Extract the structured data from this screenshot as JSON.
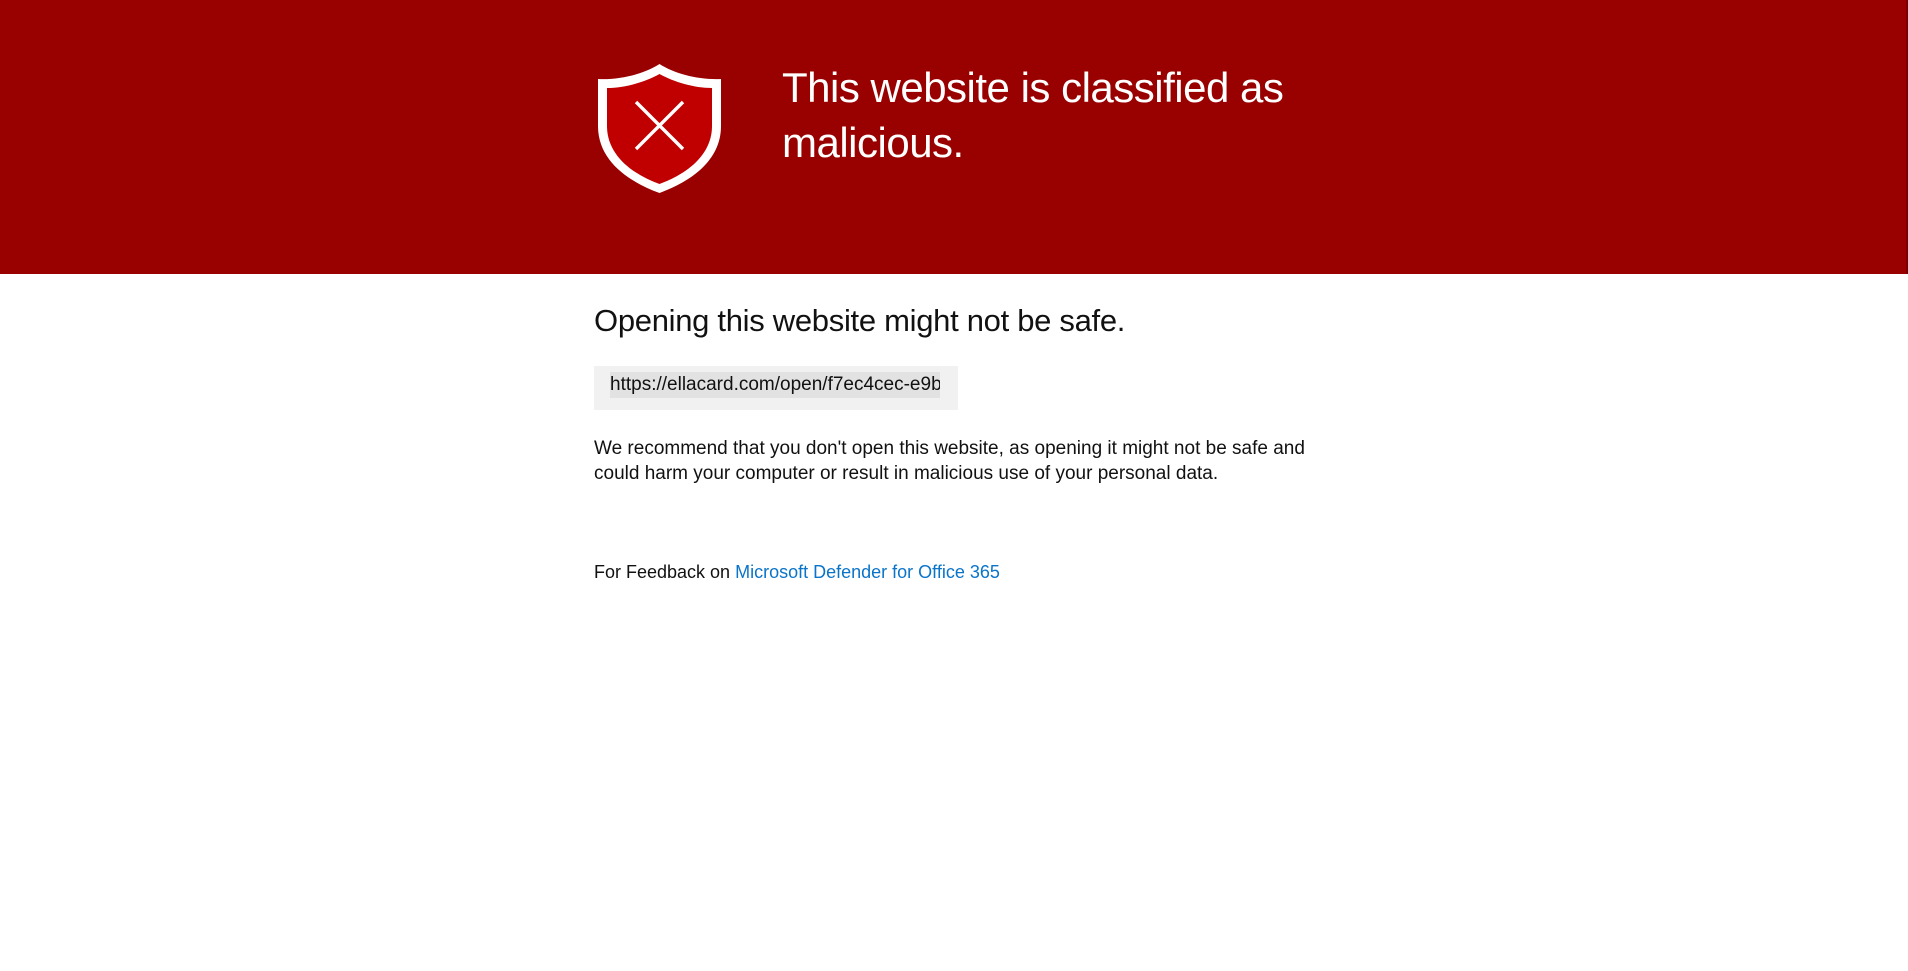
{
  "banner": {
    "title": "This website is classified as malicious.",
    "icon": "shield-x-icon",
    "background_color": "#990000",
    "shield_color": "#c00000"
  },
  "main": {
    "subheading": "Opening this website might not be safe.",
    "url": "https://ellacard.com/open/f7ec4cec-e9b...",
    "recommendation": "We recommend that you don't open this website, as opening it might not be safe and could harm your computer or result in malicious use of your personal data."
  },
  "footer": {
    "feedback_prefix": "For Feedback on",
    "feedback_link_label": "Microsoft Defender for Office 365",
    "link_color": "#0a74c9"
  }
}
